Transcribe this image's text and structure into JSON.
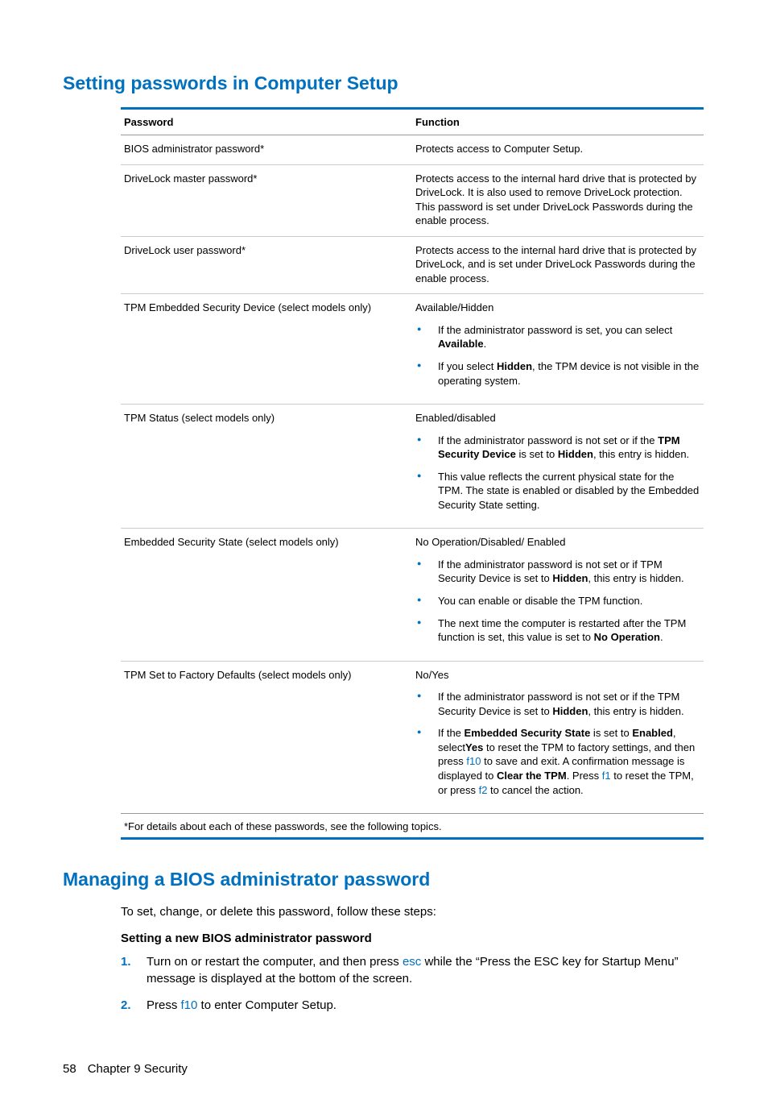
{
  "section1": {
    "title": "Setting passwords in Computer Setup",
    "headers": {
      "c1": "Password",
      "c2": "Function"
    },
    "rows": {
      "r1": {
        "c1": "BIOS administrator password*",
        "c2": "Protects access to Computer Setup."
      },
      "r2": {
        "c1": "DriveLock master password*",
        "c2": "Protects access to the internal hard drive that is protected by DriveLock. It is also used to remove DriveLock protection. This password is set under DriveLock Passwords during the enable process."
      },
      "r3": {
        "c1": "DriveLock user password*",
        "c2": "Protects access to the internal hard drive that is protected by DriveLock, and is set under DriveLock Passwords during the enable process."
      },
      "r4": {
        "c1": "TPM Embedded Security Device (select models only)",
        "top": "Available/Hidden",
        "b1a": "If the administrator password is set, you can select ",
        "b1b": "Available",
        "b1c": ".",
        "b2a": "If you select ",
        "b2b": "Hidden",
        "b2c": ", the TPM device is not visible in the operating system."
      },
      "r5": {
        "c1": "TPM Status (select models only)",
        "top": "Enabled/disabled",
        "b1a": "If the administrator password is not set or if the ",
        "b1b": "TPM Security Device",
        "b1c": " is set to ",
        "b1d": "Hidden",
        "b1e": ", this entry is hidden.",
        "b2": "This value reflects the current physical state for the TPM. The state is enabled or disabled by the Embedded Security State setting."
      },
      "r6": {
        "c1": "Embedded Security State (select models only)",
        "top": "No Operation/Disabled/ Enabled",
        "b1a": "If the administrator password is not set or if TPM Security Device is set to ",
        "b1b": "Hidden",
        "b1c": ", this entry is hidden.",
        "b2": "You can enable or disable the TPM function.",
        "b3a": "The next time the computer is restarted after the TPM function is set, this value is set to ",
        "b3b": "No Operation",
        "b3c": "."
      },
      "r7": {
        "c1": "TPM Set to Factory Defaults (select models only)",
        "top": "No/Yes",
        "b1a": "If the administrator password is not set or if the TPM Security Device is set to ",
        "b1b": "Hidden",
        "b1c": ", this entry is hidden.",
        "b2a": "If the ",
        "b2b": "Embedded Security State",
        "b2c": " is set to ",
        "b2d": "Enabled",
        "b2e": ", select",
        "b2f": "Yes",
        "b2g": " to reset the TPM to factory settings, and then press ",
        "b2h": "f10",
        "b2i": " to save and exit. A confirmation message is displayed to ",
        "b2j": "Clear the TPM",
        "b2k": ". Press ",
        "b2l": "f1",
        "b2m": " to reset the TPM, or press ",
        "b2n": "f2",
        "b2o": " to cancel the action."
      }
    },
    "footnote": "*For details about each of these passwords, see the following topics."
  },
  "section2": {
    "title": "Managing a BIOS administrator password",
    "intro": "To set, change, or delete this password, follow these steps:",
    "subheading": "Setting a new BIOS administrator password",
    "step1a": "Turn on or restart the computer, and then press ",
    "step1b": "esc",
    "step1c": " while the “Press the ESC key for Startup Menu” message is displayed at the bottom of the screen.",
    "step2a": "Press ",
    "step2b": "f10",
    "step2c": " to enter Computer Setup."
  },
  "footer": {
    "page": "58",
    "chapter": "Chapter 9   Security"
  }
}
